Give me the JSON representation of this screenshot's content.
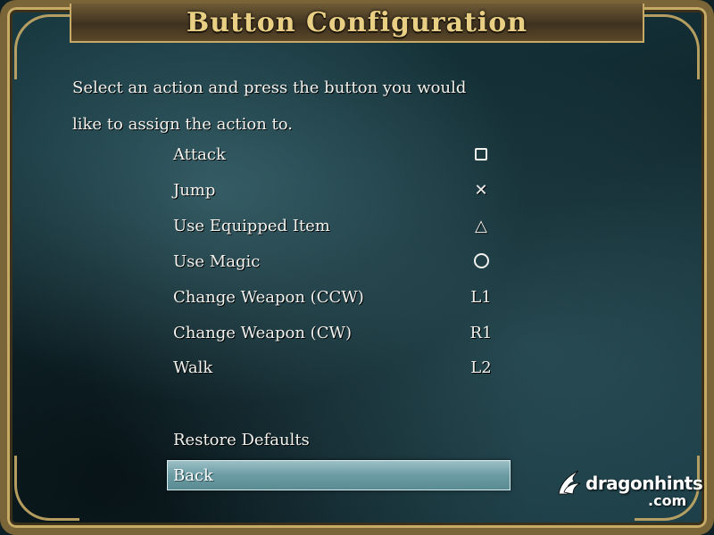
{
  "title": "Button Configuration",
  "instructions": {
    "line1": "Select an action and press the button you would",
    "line2": "like to assign the action to."
  },
  "actions": [
    {
      "label": "Attack",
      "button": "",
      "icon": "square-button-icon"
    },
    {
      "label": "Jump",
      "button": "✕",
      "icon": "cross-button-icon"
    },
    {
      "label": "Use Equipped Item",
      "button": "△",
      "icon": "triangle-button-icon"
    },
    {
      "label": "Use Magic",
      "button": "",
      "icon": "circle-button-icon"
    },
    {
      "label": "Change Weapon (CCW)",
      "button": "L1"
    },
    {
      "label": "Change Weapon (CW)",
      "button": "R1"
    },
    {
      "label": "Walk",
      "button": "L2"
    }
  ],
  "menu": {
    "restore_defaults": "Restore Defaults",
    "back": "Back"
  },
  "watermark": {
    "name": "dragonhints",
    "suffix": ".com",
    "icon": "dragon-logo-icon"
  },
  "colors": {
    "frame_gold": "#c7aa66",
    "title_text": "#e9cf84",
    "highlight": "#6b9ba3",
    "background": "#1a3c44"
  }
}
